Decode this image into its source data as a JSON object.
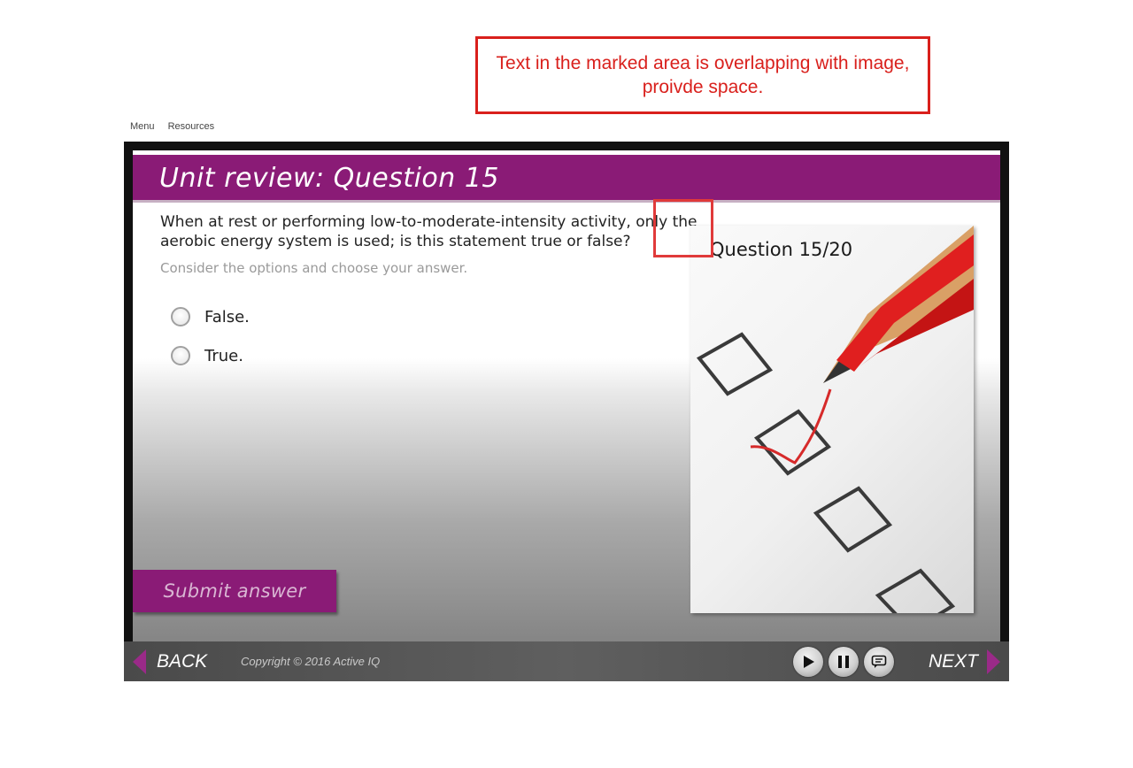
{
  "annotation": {
    "text": "Text in the marked area is overlapping with image, proivde space."
  },
  "topnav": {
    "items": [
      "Menu",
      "Resources"
    ]
  },
  "slide": {
    "title": "Unit review: Question 15",
    "question": "When at rest or performing low-to-moderate-intensity activity, only the aerobic energy system is used; is this statement true or false?",
    "instruction": "Consider the options and choose your answer.",
    "options": [
      "False.",
      "True."
    ],
    "image_caption": "Question 15/20",
    "submit_label": "Submit answer"
  },
  "footer": {
    "back_label": "BACK",
    "next_label": "NEXT",
    "copyright": "Copyright © 2016 Active IQ",
    "controls": [
      "play-icon",
      "pause-icon",
      "captions-icon"
    ]
  },
  "colors": {
    "accent": "#8a1b76",
    "annotation": "#d9201c"
  }
}
